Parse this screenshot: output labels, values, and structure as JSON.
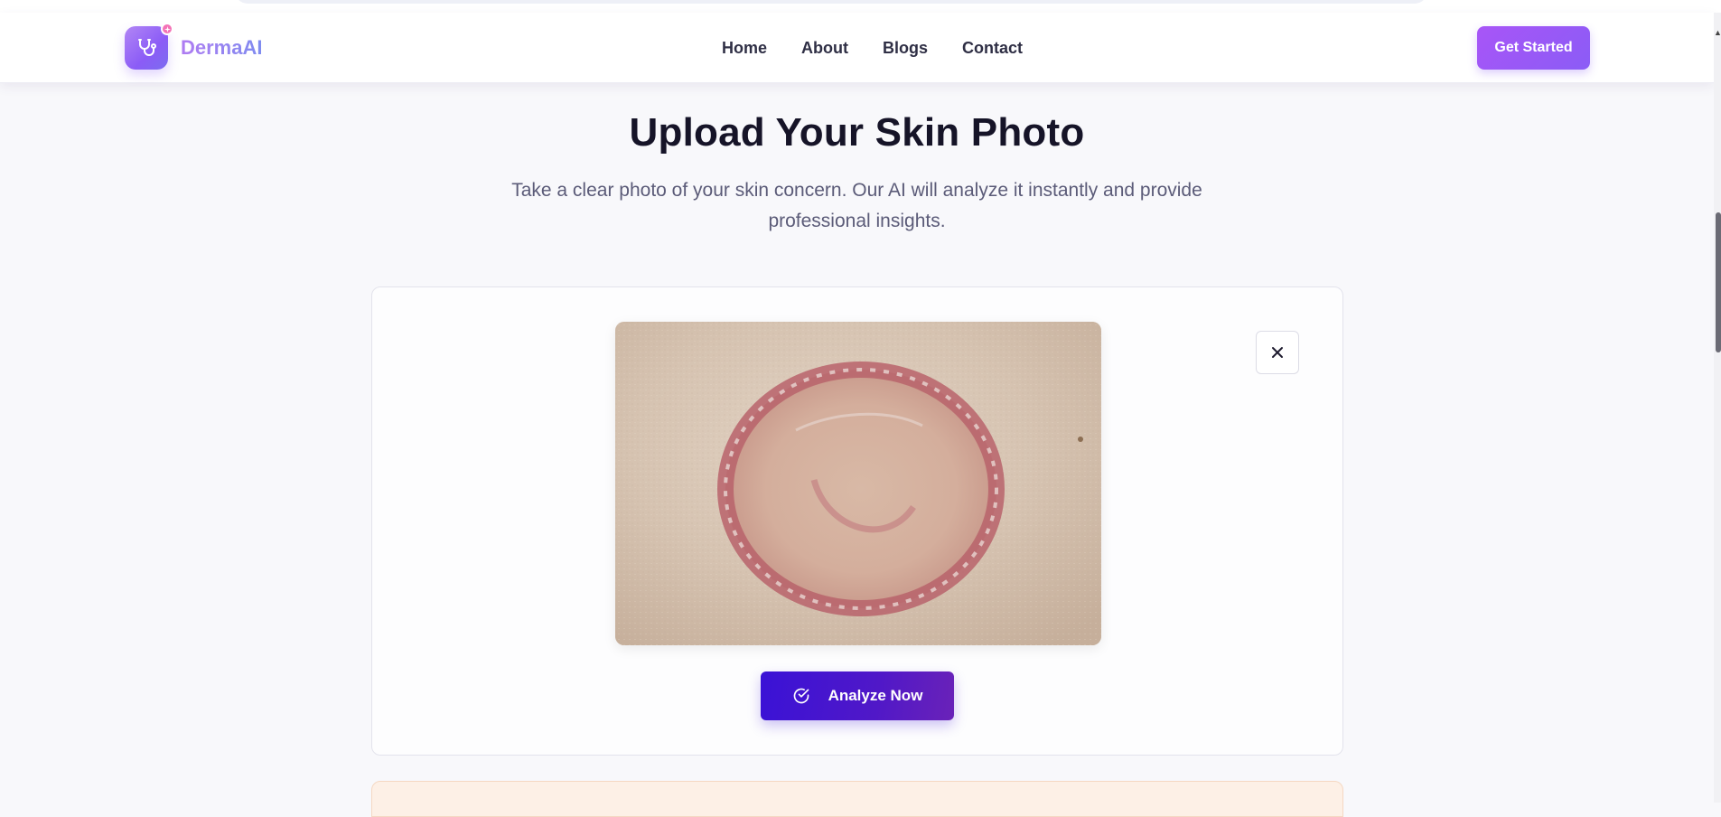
{
  "brand": {
    "name": "DermaAI",
    "logo_icon": "stethoscope-icon",
    "badge_icon": "sparkle-icon"
  },
  "nav": {
    "links": [
      {
        "label": "Home"
      },
      {
        "label": "About"
      },
      {
        "label": "Blogs"
      },
      {
        "label": "Contact"
      }
    ],
    "cta_label": "Get Started"
  },
  "hero": {
    "title": "Upload Your Skin Photo",
    "subtitle": "Take a clear photo of your skin concern. Our AI will analyze it instantly and provide professional insights."
  },
  "upload": {
    "preview_alt": "Uploaded skin photo showing a circular red rash",
    "close_icon": "close-icon",
    "analyze_label": "Analyze Now",
    "analyze_icon": "check-circle-icon"
  },
  "colors": {
    "brand_gradient_start": "#b286f5",
    "brand_gradient_end": "#8b5cf6",
    "cta": "#a855f7",
    "analyze_button": "#3a12d6",
    "page_background": "#f8f8fb",
    "warning_background": "#fdf0e6"
  }
}
